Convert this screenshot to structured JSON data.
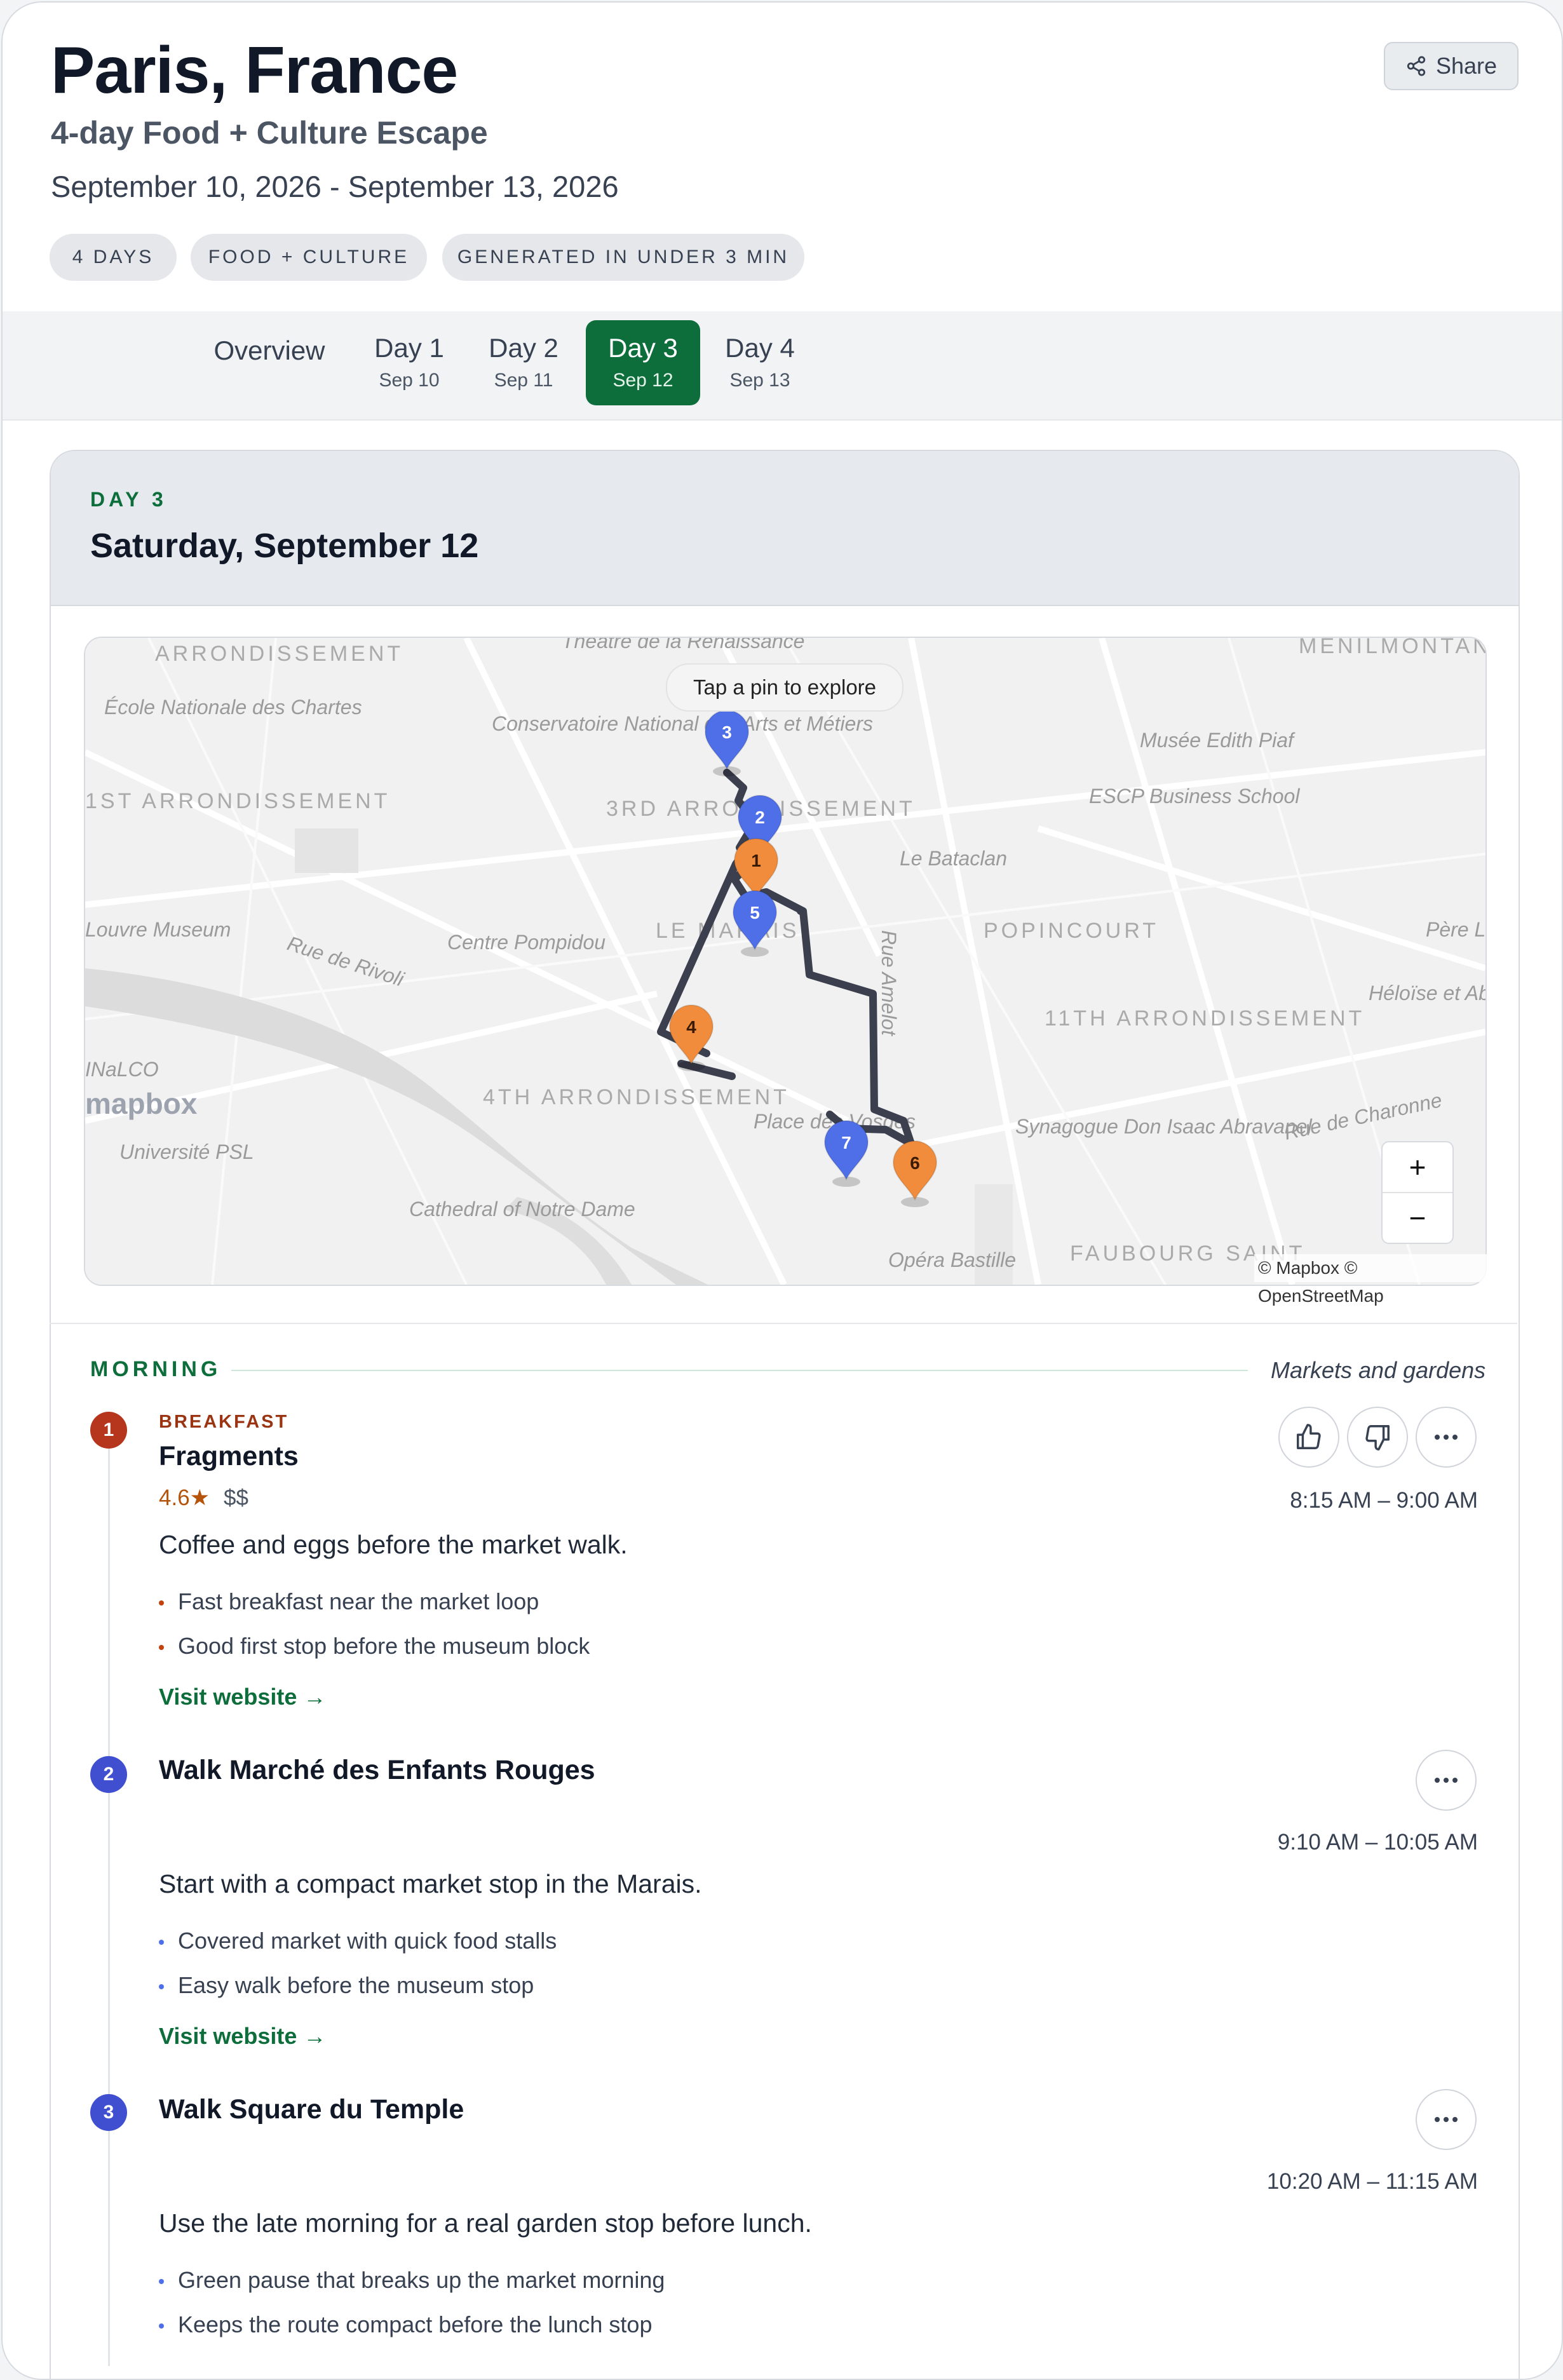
{
  "header": {
    "title": "Paris, France",
    "subtitle": "4-day Food + Culture Escape",
    "date_range": "September 10, 2026 - September 13, 2026",
    "share_label": "Share",
    "pills": [
      "4 DAYS",
      "FOOD + CULTURE",
      "GENERATED IN UNDER 3 MIN"
    ]
  },
  "tabs": [
    {
      "label": "Overview",
      "sub": ""
    },
    {
      "label": "Day 1",
      "sub": "Sep 10"
    },
    {
      "label": "Day 2",
      "sub": "Sep 11"
    },
    {
      "label": "Day 3",
      "sub": "Sep 12",
      "active": true
    },
    {
      "label": "Day 4",
      "sub": "Sep 13"
    }
  ],
  "day": {
    "label": "DAY 3",
    "date": "Saturday, September 12"
  },
  "map": {
    "hint": "Tap a pin to explore",
    "zoom_in": "+",
    "zoom_out": "−",
    "attribution": "© Mapbox © OpenStreetMap",
    "logo": "mapbox",
    "labels": [
      "ARRONDISSEMENT",
      "Théâtre de la Renaissance",
      "MENILMONTANT",
      "École Nationale des Chartes",
      "Conservatoire National des Arts et Métiers",
      "Musée Edith Piaf",
      "1ST ARRONDISSEMENT",
      "3RD ARRONDISSEMENT",
      "ESCP Business School",
      "Le Bataclan",
      "Louvre Museum",
      "Rue de Rivoli",
      "Centre Pompidou",
      "LE MARAIS",
      "Rue Amelot",
      "POPINCOURT",
      "Père Lachaise",
      "11TH ARRONDISSEMENT",
      "Héloïse et Abélard",
      "INaLCO",
      "4TH ARRONDISSEMENT",
      "Place des Vosges",
      "Synagogue Don Isaac Abravanel",
      "Rue de Charonne",
      "Université PSL",
      "Cathedral of Notre Dame",
      "Opéra Bastille",
      "FAUBOURG SAINT"
    ],
    "pins": [
      {
        "n": "1",
        "color": "#f08c3c"
      },
      {
        "n": "2",
        "color": "#4f6fe8"
      },
      {
        "n": "3",
        "color": "#4f6fe8"
      },
      {
        "n": "4",
        "color": "#f08c3c"
      },
      {
        "n": "5",
        "color": "#4f6fe8"
      },
      {
        "n": "6",
        "color": "#f08c3c"
      },
      {
        "n": "7",
        "color": "#4f6fe8"
      }
    ]
  },
  "section": {
    "name": "MORNING",
    "note": "Markets and gardens"
  },
  "items": [
    {
      "n": "1",
      "category": "BREAKFAST",
      "name": "Fragments",
      "rating": "4.6★",
      "price": "$$",
      "time": "8:15 AM – 9:00 AM",
      "desc": "Coffee and eggs before the market walk.",
      "bullets": [
        "Fast breakfast near the market loop",
        "Good first stop before the museum block"
      ],
      "link": "Visit website →"
    },
    {
      "n": "2",
      "name": "Walk Marché des Enfants Rouges",
      "time": "9:10 AM – 10:05 AM",
      "desc": "Start with a compact market stop in the Marais.",
      "bullets": [
        "Covered market with quick food stalls",
        "Easy walk before the museum stop"
      ],
      "link": "Visit website →"
    },
    {
      "n": "3",
      "name": "Walk Square du Temple",
      "time": "10:20 AM – 11:15 AM",
      "desc": "Use the late morning for a real garden stop before lunch.",
      "bullets": [
        "Green pause that breaks up the market morning",
        "Keeps the route compact before the lunch stop"
      ]
    }
  ],
  "colors": {
    "accent": "#0d6e3c",
    "food_marker": "#b5361c",
    "activity_marker": "#3f4fd0",
    "route": "#3b3f4e"
  }
}
